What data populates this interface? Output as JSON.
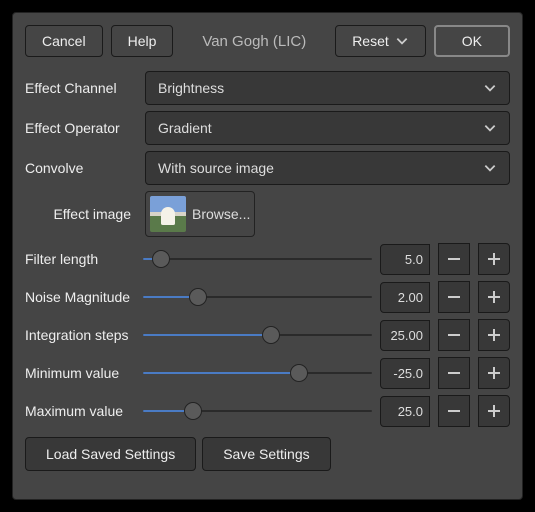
{
  "topbar": {
    "cancel": "Cancel",
    "help": "Help",
    "title": "Van Gogh (LIC)",
    "reset": "Reset",
    "ok": "OK"
  },
  "rows": {
    "effect_channel": {
      "label": "Effect Channel",
      "value": "Brightness"
    },
    "effect_operator": {
      "label": "Effect Operator",
      "value": "Gradient"
    },
    "convolve": {
      "label": "Convolve",
      "value": "With source image"
    },
    "effect_image": {
      "label": "Effect image",
      "browse": "Browse..."
    }
  },
  "sliders": [
    {
      "label": "Filter length",
      "value": "5.0",
      "fill": 8,
      "pos": 8
    },
    {
      "label": "Noise Magnitude",
      "value": "2.00",
      "fill": 24,
      "pos": 24
    },
    {
      "label": "Integration steps",
      "value": "25.00",
      "fill": 56,
      "pos": 56
    },
    {
      "label": "Minimum value",
      "value": "-25.0",
      "fill": 68,
      "pos": 68
    },
    {
      "label": "Maximum value",
      "value": "25.0",
      "fill": 22,
      "pos": 22
    }
  ],
  "bottom": {
    "load": "Load Saved Settings",
    "save": "Save Settings"
  }
}
